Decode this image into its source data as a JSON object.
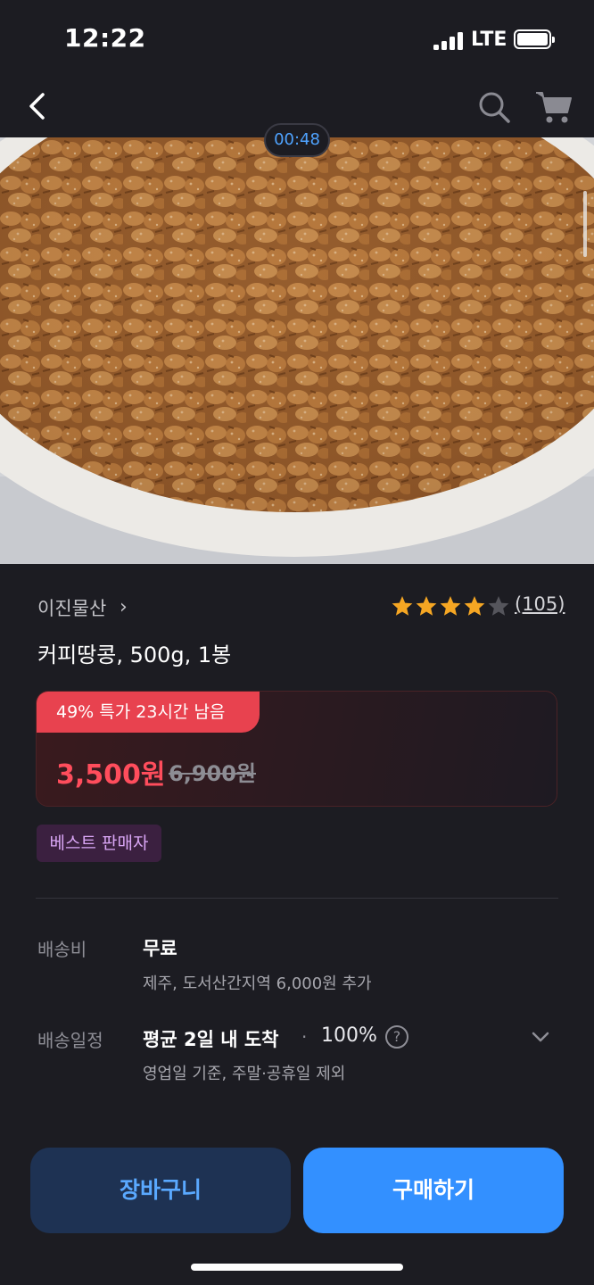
{
  "status": {
    "time": "12:22",
    "network": "LTE"
  },
  "video": {
    "timer": "00:48"
  },
  "product": {
    "seller": "이진물산",
    "seller_chevron": "›",
    "rating": 4.5,
    "review_count": "(105)",
    "title": "커피땅콩, 500g, 1봉"
  },
  "deal": {
    "tag": "49% 특가 23시간 남음",
    "sale_price": "3,500원",
    "original_price": "6,900원"
  },
  "badge": "베스트 판매자",
  "shipping": {
    "fee_label": "배송비",
    "fee_value": "무료",
    "fee_note": "제주, 도서산간지역 6,000원 추가",
    "schedule_label": "배송일정",
    "schedule_value": "평균 2일 내 도착",
    "dot": "·",
    "schedule_pct": "100%",
    "help": "?",
    "schedule_note": "영업일 기준, 주말·공휴일 제외"
  },
  "actions": {
    "cart": "장바구니",
    "buy": "구매하기"
  },
  "colors": {
    "accent_blue": "#3390ff",
    "sale_red": "#ff4d5c",
    "star": "#f5a623",
    "badge_purple": "#d9a6f5"
  }
}
